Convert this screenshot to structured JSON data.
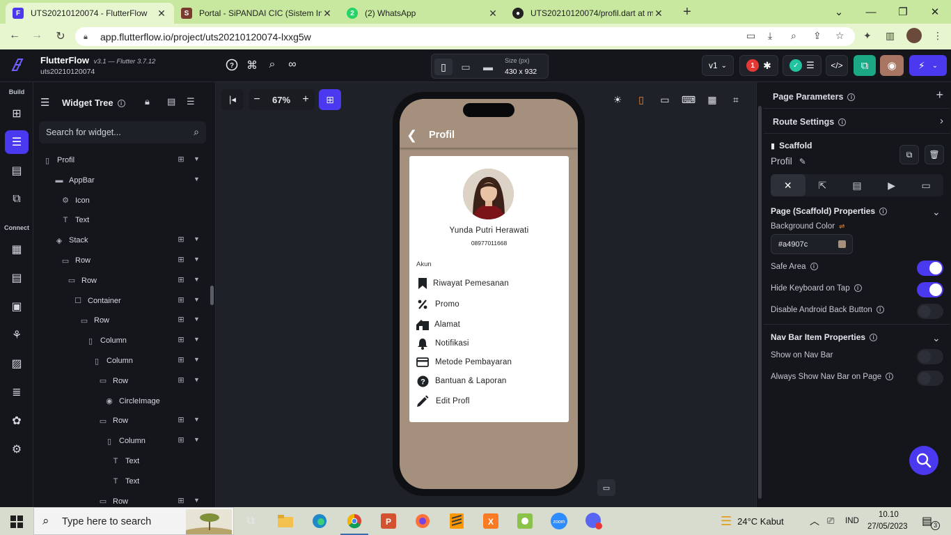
{
  "browser": {
    "tabs": [
      {
        "title": "UTS20210120074 - FlutterFlow",
        "active": true
      },
      {
        "title": "Portal - SiPANDAI CIC (Sistem Inf",
        "active": false
      },
      {
        "title": "(2) WhatsApp",
        "active": false
      },
      {
        "title": "UTS20210120074/profil.dart at m",
        "active": false
      }
    ],
    "url": "app.flutterflow.io/project/uts20210120074-lxxg5w"
  },
  "flutterflow": {
    "brand": "FlutterFlow",
    "version": "v3.1 — Flutter 3.7.12",
    "project": "uts20210120074",
    "size_label": "Size (px)",
    "size_value": "430 x 932",
    "branch": "v1",
    "issues_count": "1",
    "zoom": "67%"
  },
  "rail": {
    "build_label": "Build",
    "connect_label": "Connect"
  },
  "widget_tree": {
    "title": "Widget Tree",
    "search_placeholder": "Search for widget...",
    "items": [
      {
        "label": "Profil",
        "icon": "phone-icon",
        "depth": 0,
        "add": true
      },
      {
        "label": "AppBar",
        "icon": "appbar-icon",
        "depth": 1,
        "add": false
      },
      {
        "label": "Icon",
        "icon": "settings-icon",
        "depth": 2,
        "add": false
      },
      {
        "label": "Text",
        "icon": "text-icon",
        "depth": 2,
        "add": false
      },
      {
        "label": "Stack",
        "icon": "stack-icon",
        "depth": 1,
        "add": true
      },
      {
        "label": "Row",
        "icon": "row-icon",
        "depth": 2,
        "add": true
      },
      {
        "label": "Row",
        "icon": "row-icon",
        "depth": 3,
        "add": true
      },
      {
        "label": "Container",
        "icon": "container-icon",
        "depth": 4,
        "add": true
      },
      {
        "label": "Row",
        "icon": "row-icon",
        "depth": 5,
        "add": true
      },
      {
        "label": "Column",
        "icon": "column-icon",
        "depth": 6,
        "add": true
      },
      {
        "label": "Column",
        "icon": "column-icon",
        "depth": 7,
        "add": true
      },
      {
        "label": "Row",
        "icon": "row-icon",
        "depth": 8,
        "add": true
      },
      {
        "label": "CircleImage",
        "icon": "image-icon",
        "depth": 9,
        "add": false
      },
      {
        "label": "Row",
        "icon": "row-icon",
        "depth": 8,
        "add": true
      },
      {
        "label": "Column",
        "icon": "column-icon",
        "depth": 9,
        "add": true
      },
      {
        "label": "Text",
        "icon": "text-icon",
        "depth": 10,
        "add": false
      },
      {
        "label": "Text",
        "icon": "text-icon",
        "depth": 10,
        "add": false
      },
      {
        "label": "Row",
        "icon": "row-icon",
        "depth": 8,
        "add": true
      }
    ]
  },
  "phone": {
    "appbar_title": "Profil",
    "user_name": "Yunda Putri Herawati",
    "user_phone": "08977011668",
    "section_label": "Akun",
    "menu": [
      {
        "label": "Riwayat Pemesanan",
        "icon": "bookmark-icon"
      },
      {
        "label": "Promo",
        "icon": "percent-icon"
      },
      {
        "label": "Alamat",
        "icon": "house-icon"
      },
      {
        "label": "Notifikasi",
        "icon": "bell-icon"
      },
      {
        "label": "Metode Pembayaran",
        "icon": "credit-card-icon"
      },
      {
        "label": "Bantuan & Laporan",
        "icon": "help-icon"
      },
      {
        "label": "Edit Profl",
        "icon": "pencil-icon"
      }
    ],
    "background_color": "#a4907c"
  },
  "properties": {
    "page_parameters": "Page Parameters",
    "route_settings": "Route Settings",
    "widget_type": "Scaffold",
    "page_name": "Profil",
    "section_title": "Page (Scaffold) Properties",
    "background_color_label": "Background Color",
    "background_color_value": "#a4907c",
    "toggles": [
      {
        "label": "Safe Area",
        "on": true
      },
      {
        "label": "Hide Keyboard on Tap",
        "on": true
      },
      {
        "label": "Disable Android Back Button",
        "on": false
      }
    ],
    "nav_section_title": "Nav Bar Item Properties",
    "nav_toggles": [
      {
        "label": "Show on Nav Bar",
        "on": false
      },
      {
        "label": "Always Show Nav Bar on Page",
        "on": false
      }
    ]
  },
  "taskbar": {
    "search_placeholder": "Type here to search",
    "weather": "24°C  Kabut",
    "language": "IND",
    "time": "10.10",
    "date": "27/05/2023",
    "notification_count": "3"
  },
  "colors": {
    "accent": "#4b39ef",
    "browser_frame": "#c9e89f",
    "panel": "#14161c"
  }
}
